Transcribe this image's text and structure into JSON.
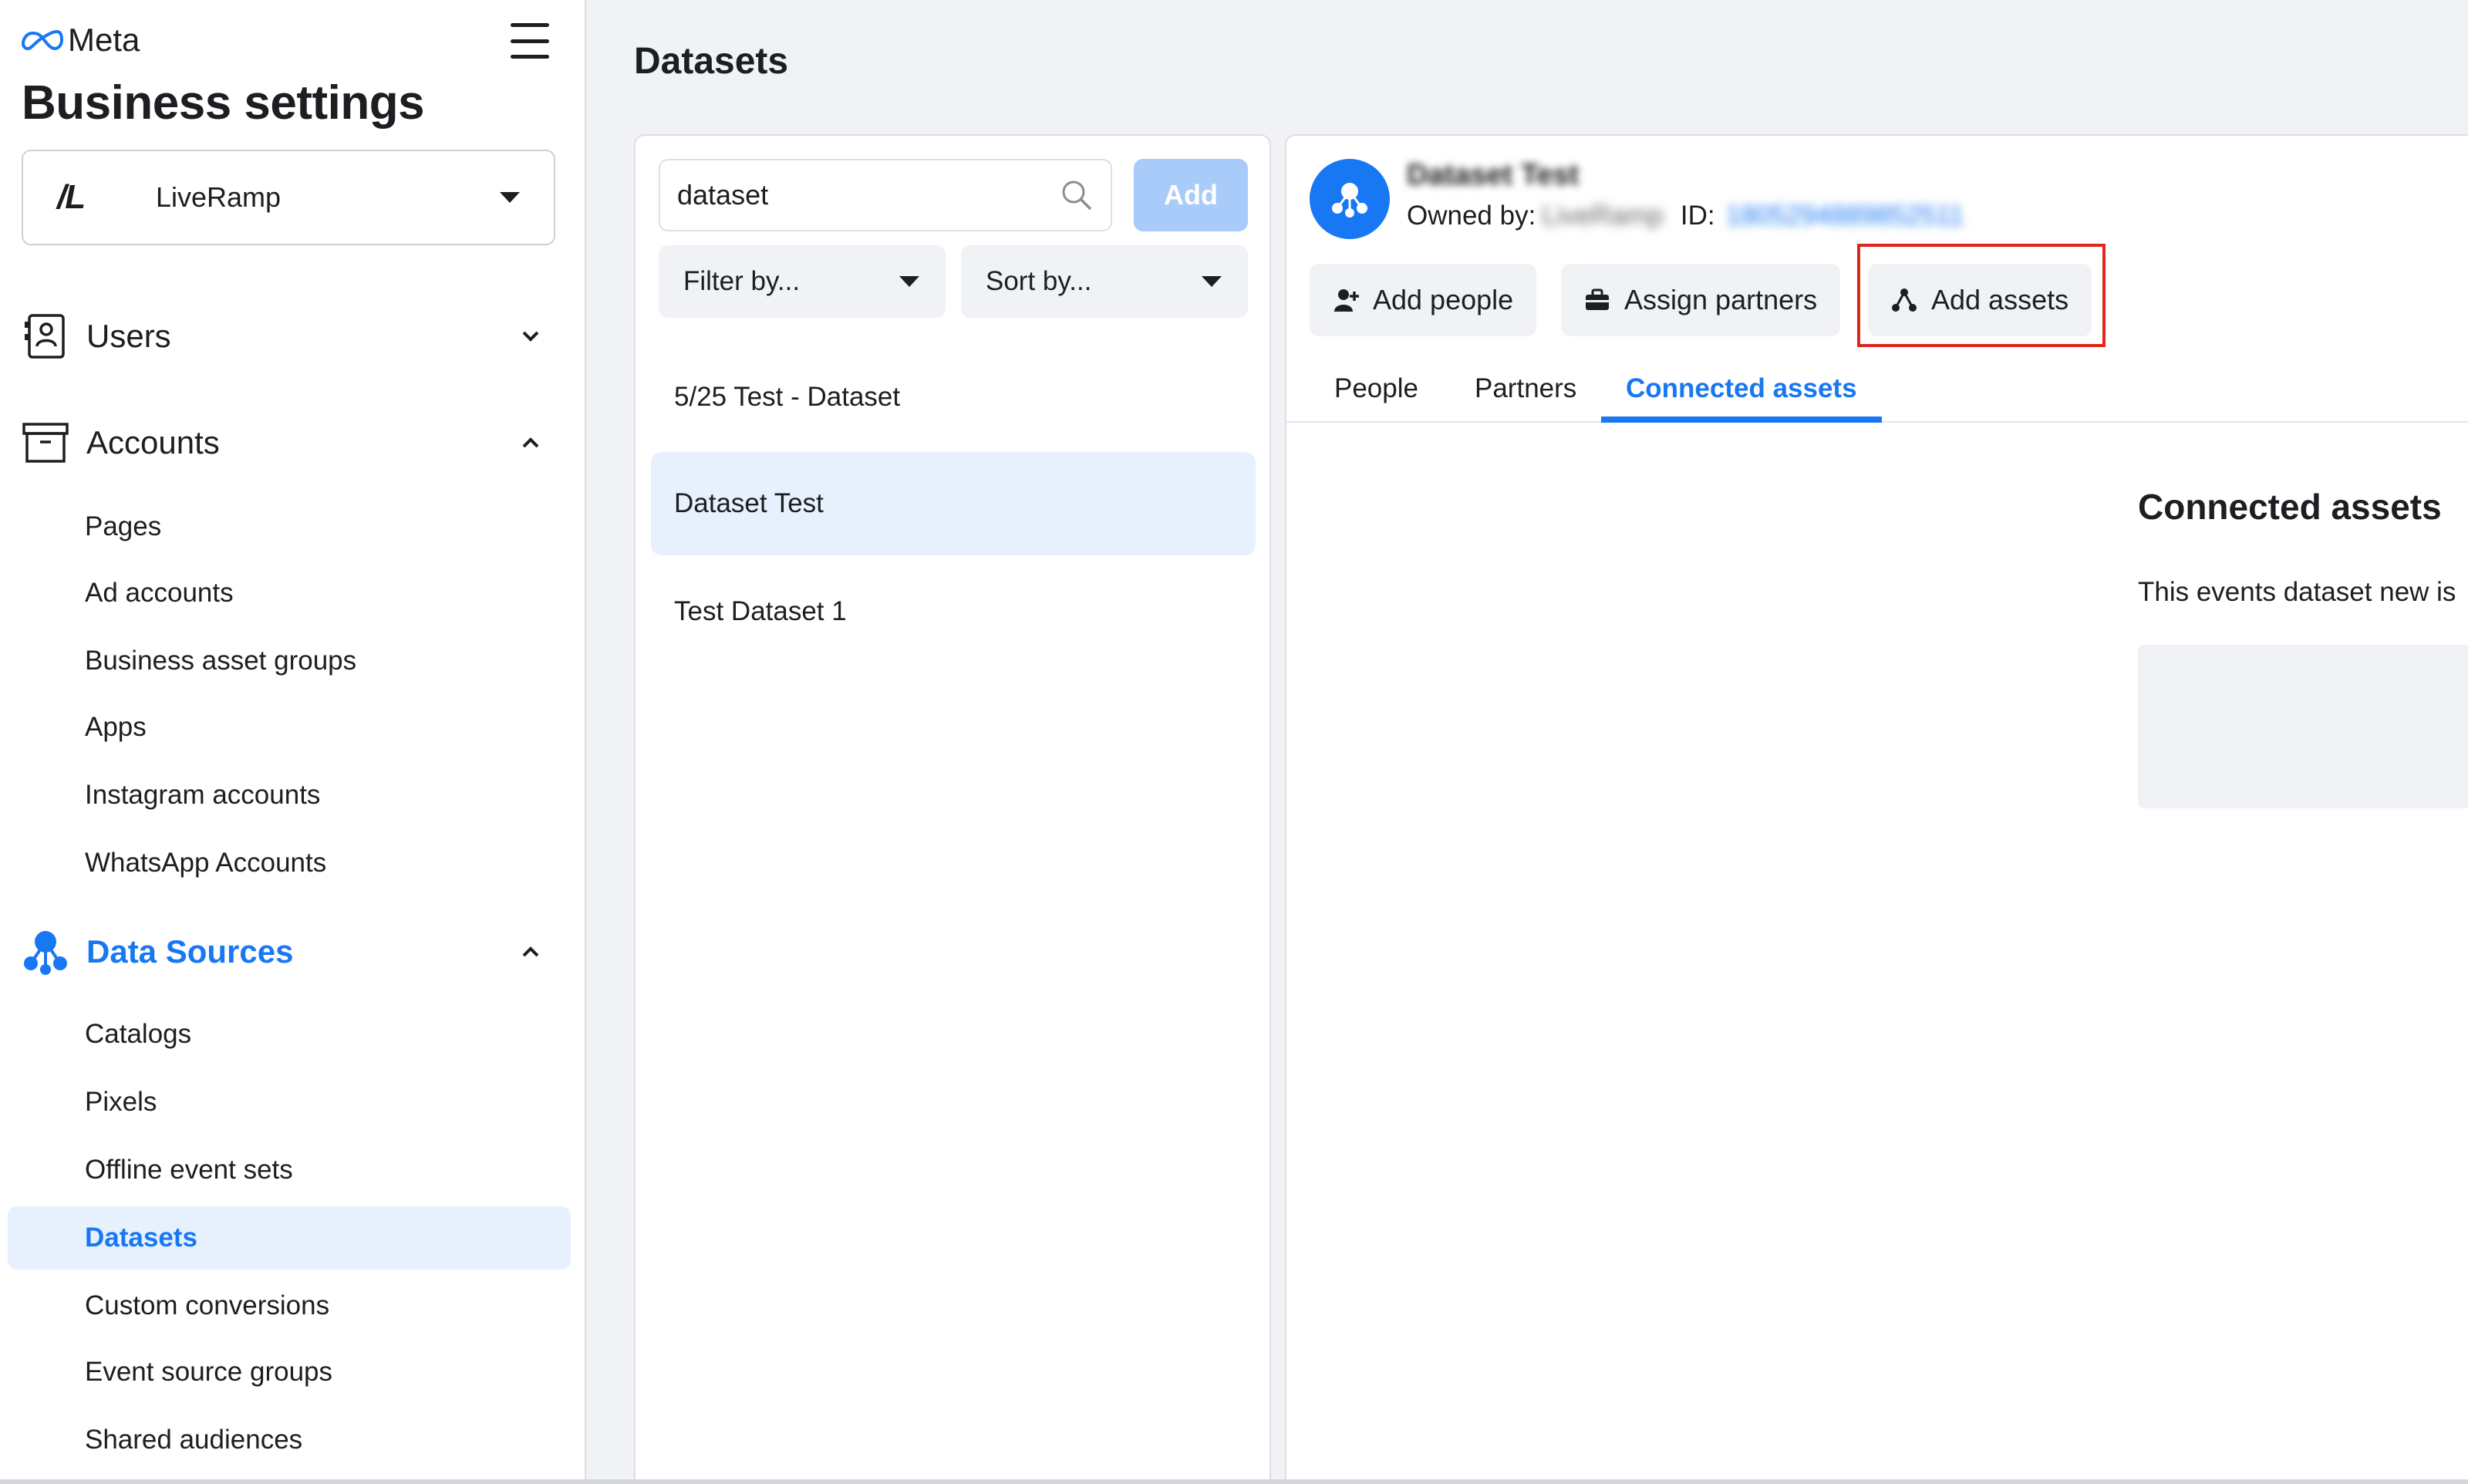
{
  "brand": {
    "name": "Meta"
  },
  "app_title": "Business settings",
  "business": {
    "logo_text": "/L",
    "name": "LiveRamp"
  },
  "sidebar": {
    "sections": [
      {
        "label": "Users",
        "icon": "users-icon",
        "expanded": false
      },
      {
        "label": "Accounts",
        "icon": "accounts-icon",
        "expanded": true,
        "items": [
          "Pages",
          "Ad accounts",
          "Business asset groups",
          "Apps",
          "Instagram accounts",
          "WhatsApp Accounts"
        ]
      },
      {
        "label": "Data Sources",
        "icon": "data-sources-icon",
        "expanded": true,
        "active": true,
        "items": [
          "Catalogs",
          "Pixels",
          "Offline event sets",
          "Datasets",
          "Custom conversions",
          "Event source groups",
          "Shared audiences"
        ],
        "selected_item": "Datasets"
      }
    ]
  },
  "page": {
    "title": "Datasets"
  },
  "list_panel": {
    "search": {
      "value": "dataset",
      "icon": "search-icon"
    },
    "add_label": "Add",
    "filter_label": "Filter by...",
    "sort_label": "Sort by...",
    "items": [
      "5/25 Test - Dataset",
      "Dataset Test",
      "Test Dataset 1"
    ],
    "selected_item": "Dataset Test"
  },
  "detail": {
    "name": "Dataset Test",
    "owned_by_label": "Owned by:",
    "owned_by_value": "LiveRamp",
    "id_label": "ID:",
    "id_value": "1805294889852511",
    "actions": [
      {
        "label": "Add people",
        "icon": "add-person-icon"
      },
      {
        "label": "Assign partners",
        "icon": "briefcase-icon"
      },
      {
        "label": "Add assets",
        "icon": "assets-icon",
        "highlighted": true
      }
    ],
    "tabs": [
      "People",
      "Partners",
      "Connected assets"
    ],
    "active_tab": "Connected assets",
    "connected_assets": {
      "title": "Connected assets",
      "description": "This events dataset new is"
    }
  },
  "colors": {
    "accent": "#1877f2",
    "highlight": "#e0251b",
    "selected_bg": "#e7f0fd",
    "add_disabled": "#a9cbf9"
  }
}
